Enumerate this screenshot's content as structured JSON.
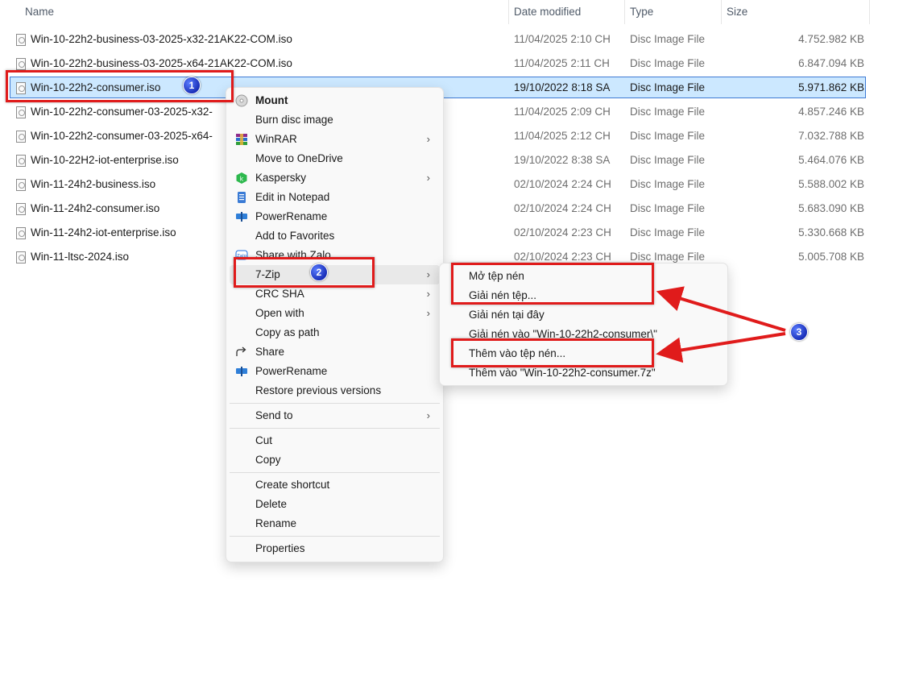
{
  "columns": {
    "name": "Name",
    "date_modified": "Date modified",
    "type": "Type",
    "size": "Size"
  },
  "files": [
    {
      "name": "Win-10-22h2-business-03-2025-x32-21AK22-COM.iso",
      "date": "11/04/2025 2:10 CH",
      "type": "Disc Image File",
      "size": "4.752.982 KB"
    },
    {
      "name": "Win-10-22h2-business-03-2025-x64-21AK22-COM.iso",
      "date": "11/04/2025 2:11 CH",
      "type": "Disc Image File",
      "size": "6.847.094 KB"
    },
    {
      "name": "Win-10-22h2-consumer.iso",
      "date": "19/10/2022 8:18 SA",
      "type": "Disc Image File",
      "size": "5.971.862 KB",
      "selected": true
    },
    {
      "name": "Win-10-22h2-consumer-03-2025-x32-",
      "date": "11/04/2025 2:09 CH",
      "type": "Disc Image File",
      "size": "4.857.246 KB"
    },
    {
      "name": "Win-10-22h2-consumer-03-2025-x64-",
      "date": "11/04/2025 2:12 CH",
      "type": "Disc Image File",
      "size": "7.032.788 KB"
    },
    {
      "name": "Win-10-22H2-iot-enterprise.iso",
      "date": "19/10/2022 8:38 SA",
      "type": "Disc Image File",
      "size": "5.464.076 KB"
    },
    {
      "name": "Win-11-24h2-business.iso",
      "date": "02/10/2024 2:24 CH",
      "type": "Disc Image File",
      "size": "5.588.002 KB"
    },
    {
      "name": "Win-11-24h2-consumer.iso",
      "date": "02/10/2024 2:24 CH",
      "type": "Disc Image File",
      "size": "5.683.090 KB"
    },
    {
      "name": "Win-11-24h2-iot-enterprise.iso",
      "date": "02/10/2024 2:23 CH",
      "type": "Disc Image File",
      "size": "5.330.668 KB"
    },
    {
      "name": "Win-11-ltsc-2024.iso",
      "date": "02/10/2024 2:23 CH",
      "type": "Disc Image File",
      "size": "5.005.708 KB"
    }
  ],
  "context_menu": {
    "items": [
      {
        "label": "Mount",
        "icon": "disc-icon"
      },
      {
        "label": "Burn disc image"
      },
      {
        "label": "WinRAR",
        "icon": "winrar-icon",
        "submenu": true
      },
      {
        "label": "Move to OneDrive"
      },
      {
        "label": "Kaspersky",
        "icon": "kaspersky-icon",
        "submenu": true
      },
      {
        "label": "Edit in Notepad",
        "icon": "notepad-icon"
      },
      {
        "label": "PowerRename",
        "icon": "powerrename-icon"
      },
      {
        "label": "Add to Favorites"
      },
      {
        "label": "Share with Zalo",
        "icon": "zalo-icon"
      },
      {
        "label": "7-Zip",
        "submenu": true
      },
      {
        "label": "CRC SHA",
        "submenu": true
      },
      {
        "label": "Open with",
        "submenu": true
      },
      {
        "label": "Copy as path"
      },
      {
        "label": "Share",
        "icon": "share-icon"
      },
      {
        "label": "PowerRename",
        "icon": "powerrename-icon"
      },
      {
        "label": "Restore previous versions"
      },
      {
        "label": "Send to",
        "submenu": true
      },
      {
        "label": "Cut"
      },
      {
        "label": "Copy"
      },
      {
        "label": "Create shortcut"
      },
      {
        "label": "Delete"
      },
      {
        "label": "Rename"
      },
      {
        "label": "Properties"
      }
    ]
  },
  "submenu_7zip": {
    "items": [
      {
        "label": "Mở tệp nén"
      },
      {
        "label": "Giải nén tệp..."
      },
      {
        "label": "Giải nén tại đây"
      },
      {
        "label": "Giải nén vào \"Win-10-22h2-consumer\\\""
      },
      {
        "label": "Thêm vào tệp nén..."
      },
      {
        "label": "Thêm vào \"Win-10-22h2-consumer.7z\""
      }
    ]
  },
  "annotations": {
    "badge_1": "1",
    "badge_2": "2",
    "badge_3": "3"
  },
  "colors": {
    "selection_bg": "#cce8ff",
    "selection_border": "#3f7bd4",
    "annotation_red": "#e01b1b",
    "badge_blue": "#1a2fb8"
  }
}
